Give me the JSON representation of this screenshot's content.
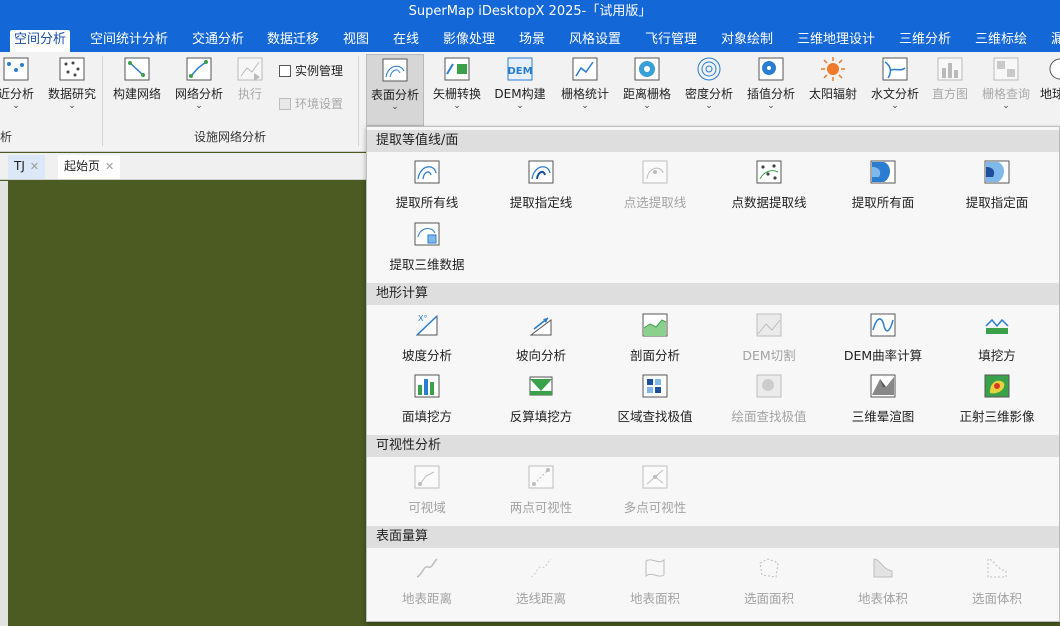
{
  "app": {
    "title": "SuperMap iDesktopX 2025-「试用版」"
  },
  "menu_tabs": [
    "空间分析",
    "空间统计分析",
    "交通分析",
    "数据迁移",
    "视图",
    "在线",
    "影像处理",
    "场景",
    "风格设置",
    "飞行管理",
    "对象绘制",
    "三维地理设计",
    "三维分析",
    "三维标绘",
    "漏"
  ],
  "ribbon": {
    "left_cut_label": "近分析",
    "left_cut_group": "析",
    "data_research": "数据研究",
    "build_network": "构建网络",
    "network_analysis": "网络分析",
    "execute": "执行",
    "instance_manage": "实例管理",
    "env_settings": "环境设置",
    "network_group": "设施网络分析",
    "surface_analysis": "表面分析",
    "vector_raster": "矢栅转换",
    "dem_build": "DEM构建",
    "raster_stats": "栅格统计",
    "distance_raster": "距离栅格",
    "density_analysis": "密度分析",
    "interpolation": "插值分析",
    "solar_radiation": "太阳辐射",
    "hydrology": "水文分析",
    "histogram": "直方图",
    "raster_query": "栅格查询",
    "right_cut": "地球"
  },
  "doc_tabs": [
    "TJ",
    "起始页"
  ],
  "dropdown": {
    "sections": [
      "提取等值线/面",
      "地形计算",
      "可视性分析",
      "表面量算"
    ],
    "contour": [
      "提取所有线",
      "提取指定线",
      "点选提取线",
      "点数据提取线",
      "提取所有面",
      "提取指定面",
      "提取三维数据"
    ],
    "terrain": [
      "坡度分析",
      "坡向分析",
      "剖面分析",
      "DEM切割",
      "DEM曲率计算",
      "填挖方",
      "面填挖方",
      "反算填挖方",
      "区域查找极值",
      "绘面查找极值",
      "三维晕渲图",
      "正射三维影像"
    ],
    "visibility": [
      "可视域",
      "两点可视性",
      "多点可视性"
    ],
    "measure": [
      "地表距离",
      "选线距离",
      "地表面积",
      "选面面积",
      "地表体积",
      "选面体积"
    ]
  },
  "colors": {
    "accent": "#1467d6",
    "map": "#4b5b21",
    "disabled": "#a3a3a3"
  }
}
